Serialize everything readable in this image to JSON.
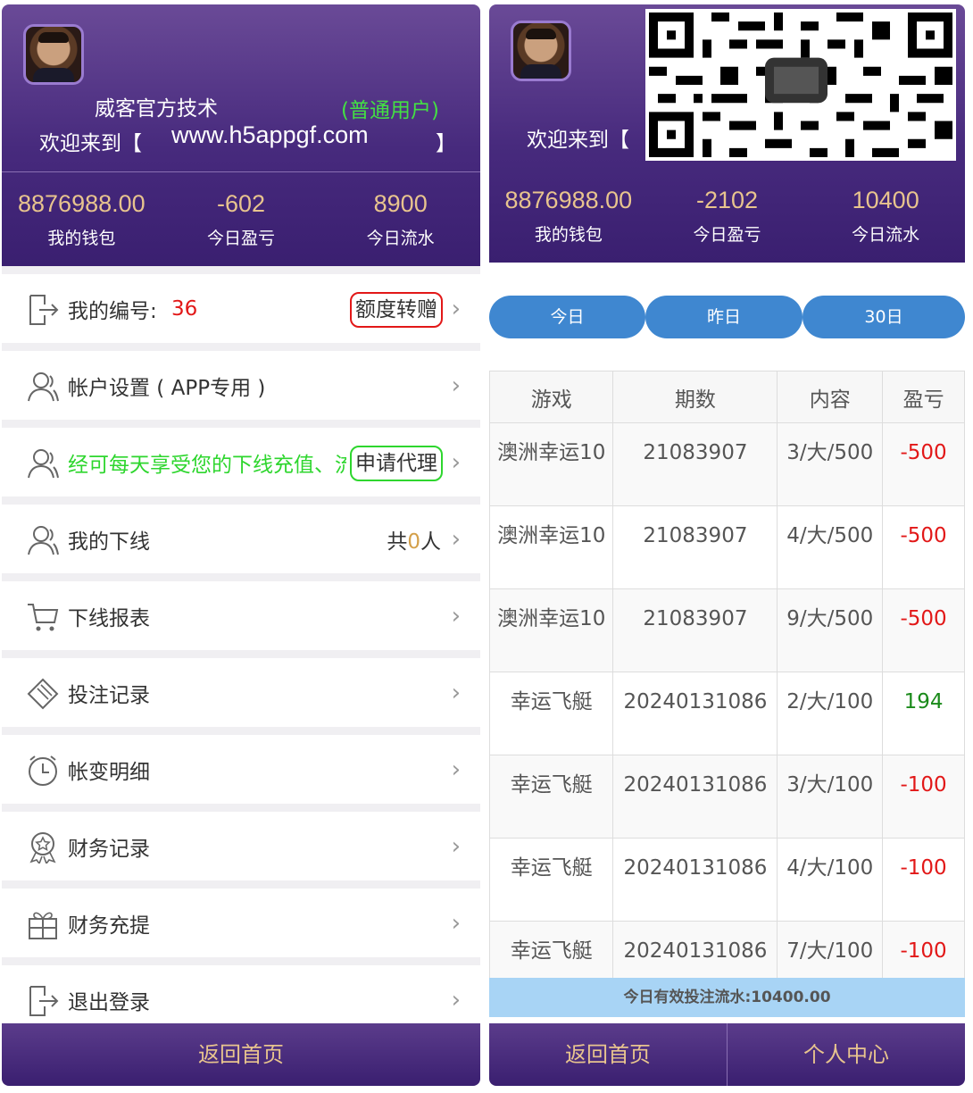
{
  "left": {
    "header": {
      "user_name": "威客官方技术",
      "user_level": "(普通用户)",
      "welcome_prefix": "欢迎来到【",
      "site": "www.h5appgf.com",
      "welcome_suffix": "】"
    },
    "stats": [
      {
        "value": "8876988.00",
        "label": "我的钱包"
      },
      {
        "value": "-602",
        "label": "今日盈亏"
      },
      {
        "value": "8900",
        "label": "今日流水"
      }
    ],
    "menu": {
      "my_id_label": "我的编号:",
      "my_id_value": "36",
      "transfer_button": "额度转赠",
      "account_settings": "帐户设置 ( APP专用 )",
      "agent_promo": "经可每天享受您的下线充值、流",
      "apply_agent_button": "申请代理",
      "my_downline": "我的下线",
      "downline_count_prefix": "共",
      "downline_count": "0",
      "downline_count_suffix": "人",
      "downline_report": "下线报表",
      "bet_records": "投注记录",
      "account_changes": "帐变明细",
      "finance_records": "财务记录",
      "deposit_withdraw": "财务充提",
      "logout": "退出登录"
    },
    "footer": {
      "home": "返回首页"
    }
  },
  "right": {
    "header": {
      "welcome_prefix": "欢迎来到【"
    },
    "stats": [
      {
        "value": "8876988.00",
        "label": "我的钱包"
      },
      {
        "value": "-2102",
        "label": "今日盈亏"
      },
      {
        "value": "10400",
        "label": "今日流水"
      }
    ],
    "tabs": [
      "今日",
      "昨日",
      "30日"
    ],
    "table": {
      "headers": [
        "游戏",
        "期数",
        "内容",
        "盈亏"
      ],
      "rows": [
        {
          "game": "澳洲幸运10",
          "period": "21083907",
          "content": "3/大/500",
          "pl": "-500"
        },
        {
          "game": "澳洲幸运10",
          "period": "21083907",
          "content": "4/大/500",
          "pl": "-500"
        },
        {
          "game": "澳洲幸运10",
          "period": "21083907",
          "content": "9/大/500",
          "pl": "-500"
        },
        {
          "game": "幸运飞艇",
          "period": "20240131086",
          "content": "2/大/100",
          "pl": "194"
        },
        {
          "game": "幸运飞艇",
          "period": "20240131086",
          "content": "3/大/100",
          "pl": "-100"
        },
        {
          "game": "幸运飞艇",
          "period": "20240131086",
          "content": "4/大/100",
          "pl": "-100"
        },
        {
          "game": "幸运飞艇",
          "period": "20240131086",
          "content": "7/大/100",
          "pl": "-100"
        }
      ]
    },
    "summary": "今日有效投注流水:10400.00",
    "footer": {
      "home": "返回首页",
      "personal": "个人中心"
    }
  },
  "colors": {
    "header_purple": "#472a7d",
    "gold": "#e8c48e",
    "tab_blue": "#3f87d0",
    "loss_red": "#e21818",
    "win_green": "#1a8a1a",
    "summary_blue": "#a8d4f5"
  }
}
